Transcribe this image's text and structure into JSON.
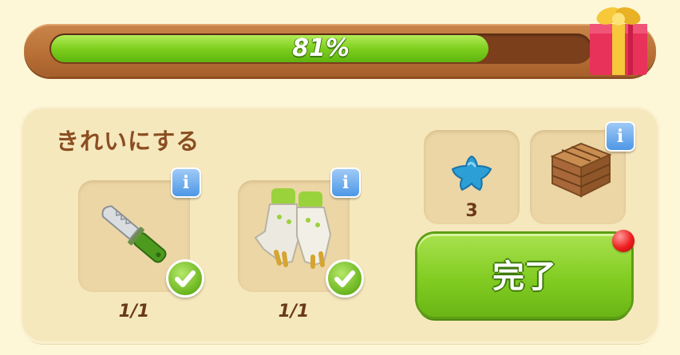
{
  "progress": {
    "label": "81%",
    "value": 0.81
  },
  "task": {
    "title": "きれいにする",
    "items": [
      {
        "icon": "knife-icon",
        "count": "1/1",
        "completed": true
      },
      {
        "icon": "gloves-icon",
        "count": "1/1",
        "completed": true
      }
    ]
  },
  "rewards": [
    {
      "icon": "blue-star-icon",
      "count": "3"
    },
    {
      "icon": "wooden-crate-icon",
      "count": ""
    }
  ],
  "buttons": {
    "done_label": "完了"
  },
  "colors": {
    "progress_green": "#7fcf1d",
    "frame_brown": "#b86f35",
    "button_green": "#82cc22",
    "info_blue": "#4d97e6",
    "badge_red": "#ee1d1d"
  }
}
